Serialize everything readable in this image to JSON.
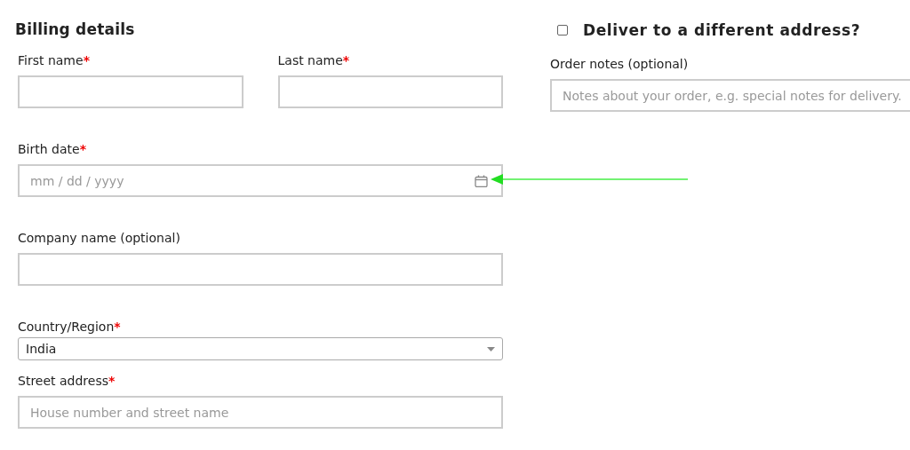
{
  "billing": {
    "title": "Billing details",
    "rows": [
      [
        {
          "kind": "text",
          "label": "First name",
          "required_mark": "*"
        },
        {
          "kind": "text",
          "label": "Last name",
          "required_mark": "*"
        }
      ],
      [
        {
          "kind": "date",
          "label": "Birth date",
          "required_mark": "*",
          "placeholder": "mm / dd / yyyy"
        }
      ],
      [
        {
          "kind": "text",
          "label": "Company name (optional)"
        }
      ],
      [
        {
          "kind": "select",
          "label": "Country/Region",
          "required_mark": "*",
          "value": "India"
        }
      ],
      [
        {
          "kind": "text",
          "label": "Street address",
          "required_mark": "*",
          "placeholder": "House number and street name"
        }
      ]
    ]
  },
  "shipping": {
    "title": "Deliver to a different address?",
    "checked": false,
    "notes": {
      "label": "Order notes (optional)",
      "placeholder": "Notes about your order, e.g. special notes for delivery."
    }
  }
}
